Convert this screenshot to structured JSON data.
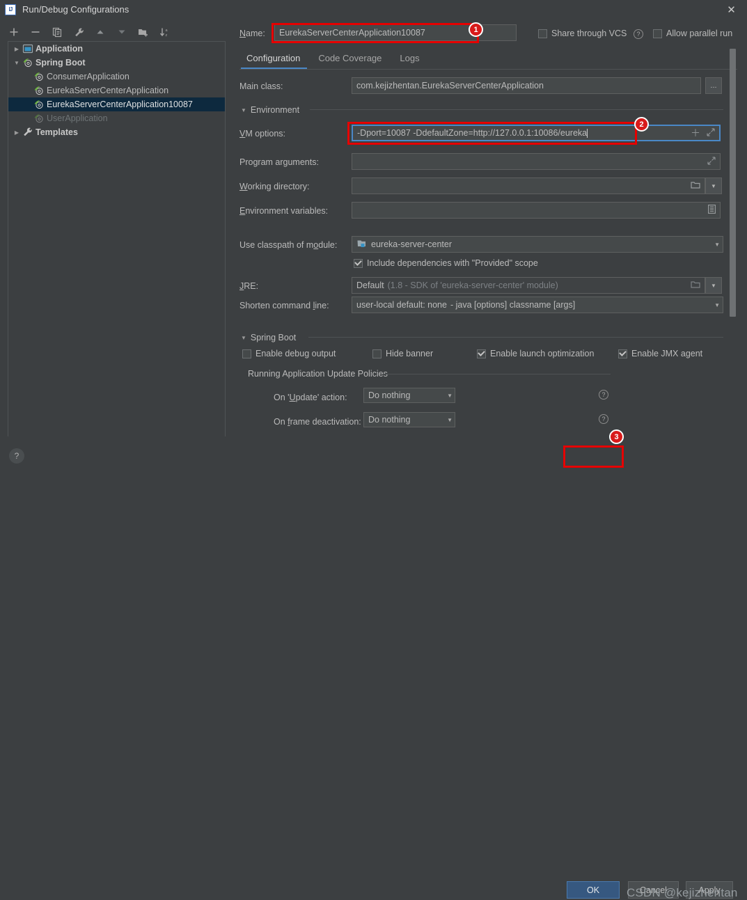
{
  "window": {
    "title": "Run/Debug Configurations",
    "app_icon": "intellij-idea-icon",
    "close_icon": "close-icon"
  },
  "left_panel": {
    "toolbar": [
      {
        "name": "add-configuration-button",
        "icon": "plus-icon",
        "glyph": "＋"
      },
      {
        "name": "remove-configuration-button",
        "icon": "minus-icon",
        "glyph": "−"
      },
      {
        "name": "copy-configuration-button",
        "icon": "copy-icon",
        "glyph": "❐"
      },
      {
        "name": "edit-templates-button",
        "icon": "wrench-icon",
        "glyph": "🔧"
      },
      {
        "name": "move-up-button",
        "icon": "arrow-up-icon",
        "glyph": "▲"
      },
      {
        "name": "move-down-button",
        "icon": "arrow-down-icon",
        "glyph": "▼"
      },
      {
        "name": "create-folder-button",
        "icon": "folder-add-icon",
        "glyph": "📁"
      },
      {
        "name": "sort-configurations-button",
        "icon": "sort-az-icon",
        "glyph": "↓"
      }
    ],
    "tree": [
      {
        "label": "Application",
        "arrow": "▶",
        "icon": "application-icon",
        "indent": 1,
        "bold": true,
        "selected": false,
        "dim": false
      },
      {
        "label": "Spring Boot",
        "arrow": "▼",
        "icon": "spring-boot-icon",
        "indent": 1,
        "bold": true,
        "selected": false,
        "dim": false
      },
      {
        "label": "ConsumerApplication",
        "arrow": "",
        "icon": "spring-boot-icon",
        "indent": 2,
        "bold": false,
        "selected": false,
        "dim": false
      },
      {
        "label": "EurekaServerCenterApplication",
        "arrow": "",
        "icon": "spring-boot-icon",
        "indent": 2,
        "bold": false,
        "selected": false,
        "dim": false
      },
      {
        "label": "EurekaServerCenterApplication10087",
        "arrow": "",
        "icon": "spring-boot-icon",
        "indent": 2,
        "bold": false,
        "selected": true,
        "dim": false
      },
      {
        "label": "UserApplication",
        "arrow": "",
        "icon": "spring-boot-icon",
        "indent": 2,
        "bold": false,
        "selected": false,
        "dim": true
      },
      {
        "label": "Templates",
        "arrow": "▶",
        "icon": "wrench-icon",
        "indent": 1,
        "bold": true,
        "selected": false,
        "dim": false
      }
    ]
  },
  "header": {
    "name_label": "Name:",
    "name_value": "EurekaServerCenterApplication10087",
    "share_vcs_label": "Share through VCS",
    "share_vcs_checked": false,
    "share_vcs_help_icon": "help-icon",
    "allow_parallel_label": "Allow parallel run",
    "allow_parallel_checked": false
  },
  "tabs": [
    {
      "label": "Configuration",
      "active": true
    },
    {
      "label": "Code Coverage",
      "active": false
    },
    {
      "label": "Logs",
      "active": false
    }
  ],
  "form": {
    "main_class_label": "Main class:",
    "main_class_value": "com.kejizhentan.EurekaServerCenterApplication",
    "main_class_browse": "...",
    "environment_group": "Environment",
    "vm_options_label": "VM options:",
    "vm_options_value": "-Dport=10087 -DdefaultZone=http://127.0.0.1:10086/eureka",
    "vm_options_add_icon": "plus-icon",
    "vm_options_expand_icon": "expand-icon",
    "program_arguments_label": "Program arguments:",
    "program_arguments_value": "",
    "program_arguments_expand_icon": "expand-icon",
    "working_directory_label": "Working directory:",
    "working_directory_value": "",
    "working_directory_browse_icon": "folder-icon",
    "working_directory_caret_icon": "chevron-down-icon",
    "environment_variables_label": "Environment variables:",
    "environment_variables_value": "",
    "environment_variables_edit_icon": "list-icon",
    "classpath_label": "Use classpath of module:",
    "classpath_value": "eureka-server-center",
    "classpath_icon": "module-icon",
    "include_provided_label": "Include dependencies with \"Provided\" scope",
    "include_provided_checked": true,
    "jre_label": "JRE:",
    "jre_value": "Default",
    "jre_value_hint": "(1.8 - SDK of 'eureka-server-center' module)",
    "jre_browse_icon": "folder-icon",
    "jre_caret_icon": "chevron-down-icon",
    "shorten_cmd_label": "Shorten command line:",
    "shorten_cmd_value": "user-local default: none",
    "shorten_cmd_hint": "- java [options] classname [args]"
  },
  "spring_boot": {
    "group_label": "Spring Boot",
    "checkboxes": [
      {
        "label": "Enable debug output",
        "checked": false
      },
      {
        "label": "Hide banner",
        "checked": false
      },
      {
        "label": "Enable launch optimization",
        "checked": true
      },
      {
        "label": "Enable JMX agent",
        "checked": true
      }
    ],
    "update_policies_label": "Running Application Update Policies",
    "on_update_label": "On 'Update' action:",
    "on_update_value": "Do nothing",
    "on_update_help_icon": "help-icon",
    "on_frame_label": "On frame deactivation:",
    "on_frame_value": "Do nothing",
    "on_frame_help_icon": "help-icon"
  },
  "footer": {
    "help_label": "?",
    "ok_label": "OK",
    "cancel_label": "Cancel",
    "apply_label": "Apply",
    "watermark": "CSDN @kejizhentan"
  },
  "annotations": [
    {
      "number": "1"
    },
    {
      "number": "2"
    },
    {
      "number": "3"
    }
  ],
  "colors": {
    "background": "#3c3f41",
    "field": "#45494a",
    "selection": "#0d293e",
    "accent": "#4a88c7",
    "primary_button": "#365880",
    "annotation_red": "#e60000"
  }
}
